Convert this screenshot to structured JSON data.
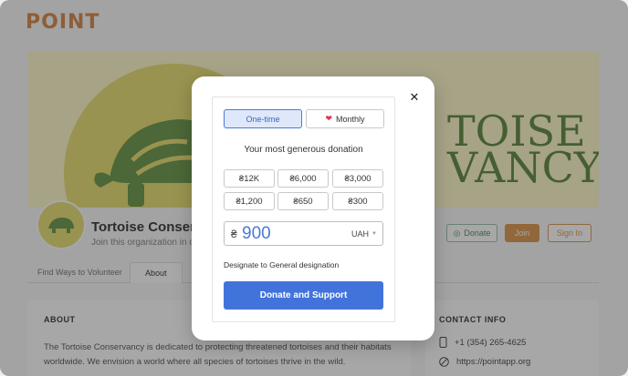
{
  "brand": {
    "logo": "POINT",
    "accent": "#d17a33"
  },
  "banner": {
    "line1": "TOISE",
    "line2": "VANCY"
  },
  "org": {
    "name": "Tortoise Conserva",
    "subtitle": "Join this organization in ord"
  },
  "header_actions": {
    "donate_label": "Donate",
    "join_label": "Join",
    "signin_label": "Sign In"
  },
  "tabs": [
    {
      "label": "Find Ways to Volunteer"
    },
    {
      "label": "About"
    }
  ],
  "about": {
    "heading": "ABOUT",
    "text": "The Tortoise Conservancy is dedicated to protecting threatened tortoises and their habitats worldwide. We envision a world where all species of tortoises thrive in the wild."
  },
  "contact": {
    "heading": "CONTACT INFO",
    "phone": "+1 (354) 265-4625",
    "website": "https://pointapp.org"
  },
  "donation_modal": {
    "close_icon": "close-icon",
    "frequency": {
      "one_time": "One-time",
      "monthly": "Monthly",
      "selected": "One-time"
    },
    "headline": "Your most generous donation",
    "amounts": [
      "₴12K",
      "₴6,000",
      "₴3,000",
      "₴1,200",
      "₴650",
      "₴300"
    ],
    "currency_symbol": "₴",
    "amount_value": "900",
    "currency": "UAH",
    "designation": "Designate to General designation",
    "submit_label": "Donate and Support",
    "primary_color": "#4273db"
  }
}
